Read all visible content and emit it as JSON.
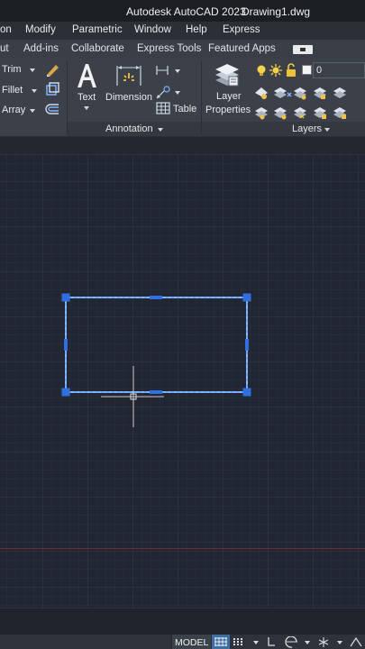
{
  "app": {
    "title": "Autodesk AutoCAD 2023",
    "document": "Drawing1.dwg"
  },
  "menubar": {
    "items": [
      "on",
      "Modify",
      "Parametric",
      "Window",
      "Help",
      "Express"
    ]
  },
  "ribbon_tabs": {
    "items": [
      "ut",
      "Add-ins",
      "Collaborate",
      "Express Tools",
      "Featured Apps"
    ]
  },
  "modify_panel": {
    "trim": "Trim",
    "fillet": "Fillet",
    "array": "Array"
  },
  "annotation_panel": {
    "text": "Text",
    "dimension": "Dimension",
    "table": "Table",
    "title": "Annotation"
  },
  "layers_panel": {
    "layer_properties_1": "Layer",
    "layer_properties_2": "Properties",
    "current_layer": "0",
    "title": "Layers"
  },
  "status": {
    "model": "MODEL"
  },
  "colors": {
    "selection": "#5a9cf0",
    "grip": "#2f6fe0",
    "crosshair": "#c8c8c8"
  }
}
